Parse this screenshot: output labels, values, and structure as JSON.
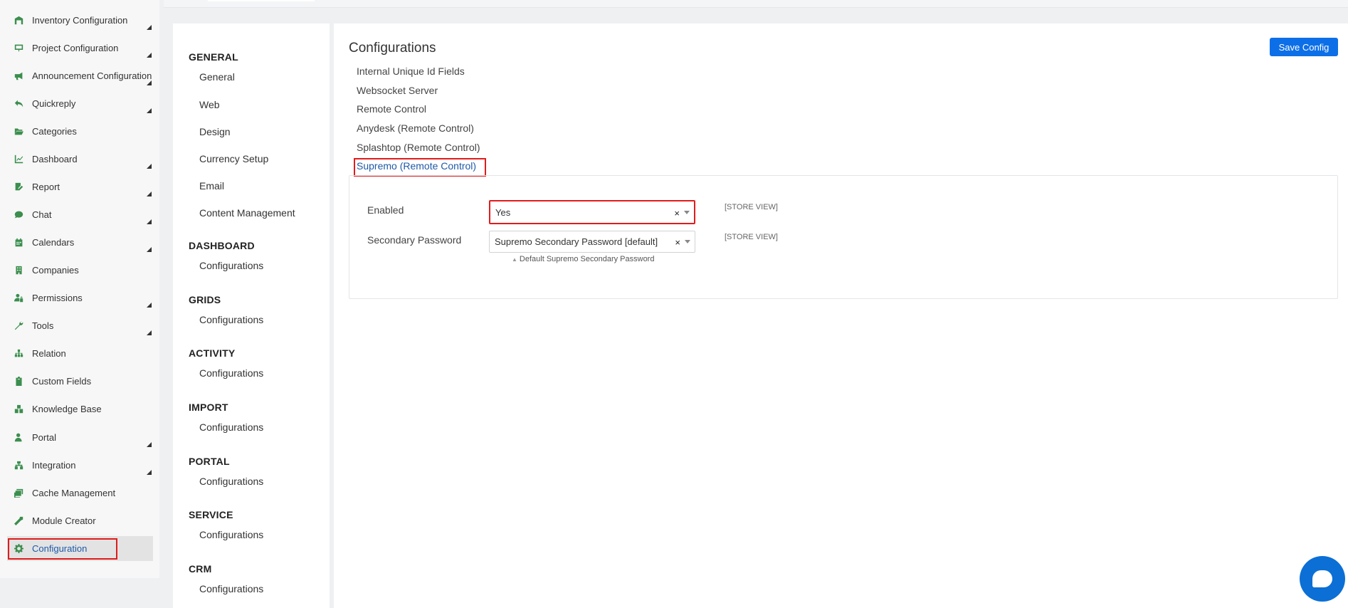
{
  "sidebar": {
    "items": [
      {
        "label": "Inventory Configuration",
        "icon": "warehouse-icon",
        "expandable": true,
        "active": false
      },
      {
        "label": "Project Configuration",
        "icon": "presentation-icon",
        "expandable": true,
        "active": false
      },
      {
        "label": "Announcement Configuration",
        "icon": "megaphone-icon",
        "expandable": true,
        "active": false
      },
      {
        "label": "Quickreply",
        "icon": "reply-icon",
        "expandable": true,
        "active": false
      },
      {
        "label": "Categories",
        "icon": "folder-open-icon",
        "expandable": false,
        "active": false
      },
      {
        "label": "Dashboard",
        "icon": "line-chart-icon",
        "expandable": true,
        "active": false
      },
      {
        "label": "Report",
        "icon": "report-edit-icon",
        "expandable": true,
        "active": false
      },
      {
        "label": "Chat",
        "icon": "chat-bubble-icon",
        "expandable": true,
        "active": false
      },
      {
        "label": "Calendars",
        "icon": "calendar-icon",
        "expandable": true,
        "active": false
      },
      {
        "label": "Companies",
        "icon": "building-icon",
        "expandable": false,
        "active": false
      },
      {
        "label": "Permissions",
        "icon": "user-lock-icon",
        "expandable": true,
        "active": false
      },
      {
        "label": "Tools",
        "icon": "wrench-icon",
        "expandable": true,
        "active": false
      },
      {
        "label": "Relation",
        "icon": "sitemap-icon",
        "expandable": false,
        "active": false
      },
      {
        "label": "Custom Fields",
        "icon": "clipboard-icon",
        "expandable": false,
        "active": false
      },
      {
        "label": "Knowledge Base",
        "icon": "boxes-icon",
        "expandable": false,
        "active": false
      },
      {
        "label": "Portal",
        "icon": "user-icon",
        "expandable": true,
        "active": false
      },
      {
        "label": "Integration",
        "icon": "network-icon",
        "expandable": true,
        "active": false
      },
      {
        "label": "Cache Management",
        "icon": "layers-icon",
        "expandable": false,
        "active": false
      },
      {
        "label": "Module Creator",
        "icon": "magic-wand-icon",
        "expandable": false,
        "active": false
      },
      {
        "label": "Configuration",
        "icon": "gear-icon",
        "expandable": false,
        "active": true
      }
    ]
  },
  "nav": {
    "groups": [
      {
        "heading": "GENERAL",
        "links": [
          "General",
          "Web",
          "Design",
          "Currency Setup",
          "Email",
          "Content Management"
        ]
      },
      {
        "heading": "DASHBOARD",
        "links": [
          "Configurations"
        ]
      },
      {
        "heading": "GRIDS",
        "links": [
          "Configurations"
        ]
      },
      {
        "heading": "ACTIVITY",
        "links": [
          "Configurations"
        ]
      },
      {
        "heading": "IMPORT",
        "links": [
          "Configurations"
        ]
      },
      {
        "heading": "PORTAL",
        "links": [
          "Configurations"
        ]
      },
      {
        "heading": "SERVICE",
        "links": [
          "Configurations"
        ]
      },
      {
        "heading": "CRM",
        "links": [
          "Configurations"
        ]
      }
    ]
  },
  "main": {
    "title": "Configurations",
    "save_label": "Save Config",
    "sections": [
      "Internal Unique Id Fields",
      "Websocket Server",
      "Remote Control",
      "Anydesk (Remote Control)",
      "Splashtop (Remote Control)",
      "Supremo (Remote Control)"
    ],
    "active_section": "Supremo (Remote Control)",
    "fields": [
      {
        "label": "Enabled",
        "value": "Yes",
        "clear": "×",
        "scope": "[STORE VIEW]",
        "hint": ""
      },
      {
        "label": "Secondary Password",
        "value": "Supremo Secondary Password [default]",
        "clear": "×",
        "scope": "[STORE VIEW]",
        "hint": "Default Supremo Secondary Password"
      }
    ]
  },
  "colors": {
    "accent": "#0d6fe8",
    "icon_green": "#3b8e4e",
    "highlight_red": "#e01c1c",
    "active_link": "#1e5aa8"
  }
}
